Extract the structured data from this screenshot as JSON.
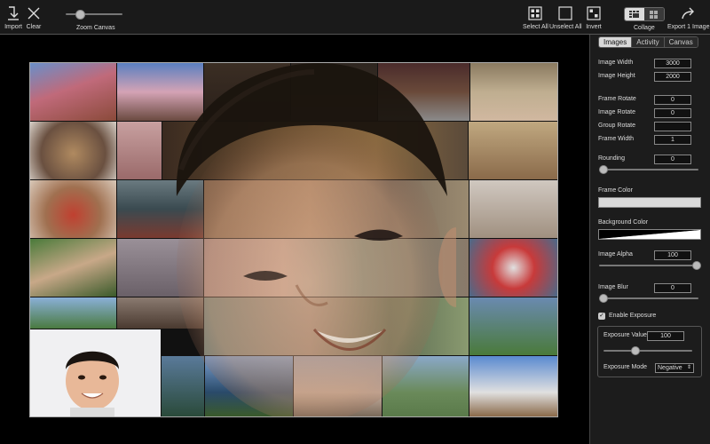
{
  "toolbar": {
    "import_label": "Import",
    "clear_label": "Clear",
    "zoom_label": "Zoom Canvas",
    "zoom_level": 0.2,
    "select_all_label": "Select All",
    "unselect_all_label": "Unselect All",
    "invert_label": "Invert",
    "collage_label": "Collage",
    "export_label": "Export 1 Image"
  },
  "panel": {
    "tabs": [
      {
        "label": "Images",
        "active": true
      },
      {
        "label": "Activity",
        "active": false
      },
      {
        "label": "Canvas",
        "active": false
      }
    ],
    "image_width_label": "Image Width",
    "image_width_value": "3000",
    "image_height_label": "Image Height",
    "image_height_value": "2000",
    "frame_rotate_label": "Frame Rotate",
    "frame_rotate_value": "0",
    "image_rotate_label": "Image Rotate",
    "image_rotate_value": "0",
    "group_rotate_label": "Group Rotate",
    "group_rotate_value": "",
    "frame_width_label": "Frame Width",
    "frame_width_value": "1",
    "rounding_label": "Rounding",
    "rounding_value": "0",
    "frame_color_label": "Frame Color",
    "background_color_label": "Background Color",
    "image_alpha_label": "Image Alpha",
    "image_alpha_value": "100",
    "image_blur_label": "Image Blur",
    "image_blur_value": "0",
    "enable_exposure_label": "Enable Exposure",
    "exposure_value_label": "Exposure Value",
    "exposure_value": "100",
    "exposure_mode_label": "Exposure Mode",
    "exposure_mode_value": "Negative"
  },
  "colors": {
    "frame_color": "#d9d9d9",
    "accent": "#d8d8d8"
  }
}
